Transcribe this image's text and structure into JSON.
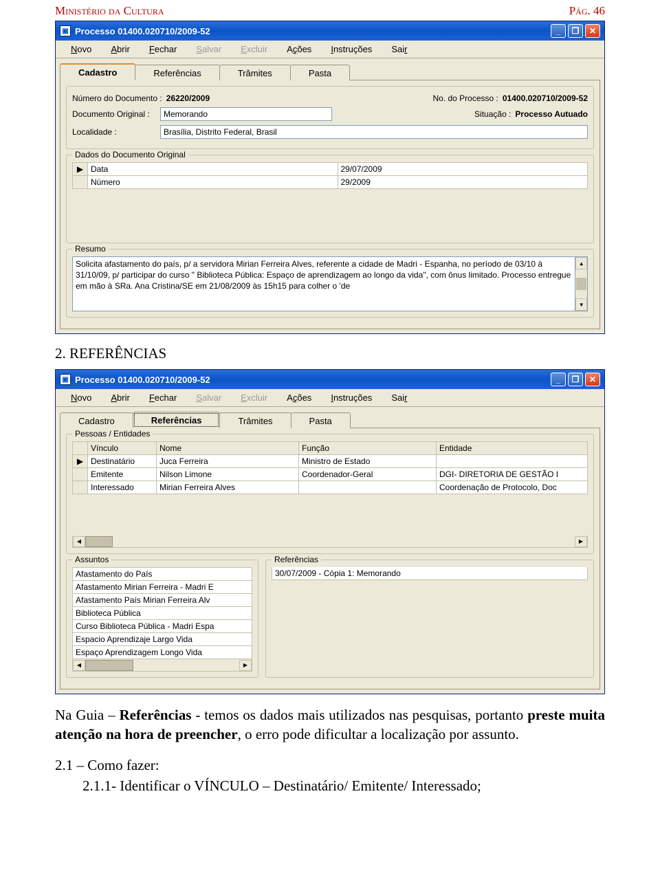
{
  "doc": {
    "ministry": "Ministério da Cultura",
    "page": "Pág. 46",
    "section_title": "2. REFERÊNCIAS",
    "paragraph1_a": "Na Guia – ",
    "paragraph1_b": "Referências",
    "paragraph1_c": " - temos os dados mais utilizados nas pesquisas, portanto ",
    "paragraph1_d": "preste muita atenção na hora de preencher",
    "paragraph1_e": ", o erro pode dificultar a localização por assunto.",
    "paragraph2": "2.1 – Como fazer:",
    "paragraph3": "2.1.1- Identificar o VÍNCULO – Destinatário/ Emitente/ Interessado;"
  },
  "win1": {
    "title": "Processo 01400.020710/2009-52",
    "minimize": "_",
    "restore": "❐",
    "close": "✕",
    "menu": {
      "novo": "Novo",
      "abrir": "Abrir",
      "fechar": "Fechar",
      "salvar": "Salvar",
      "excluir": "Excluir",
      "acoes": "Ações",
      "instrucoes": "Instruções",
      "sair": "Sair"
    },
    "tabs": {
      "cadastro": "Cadastro",
      "referencias": "Referências",
      "tramites": "Trâmites",
      "pasta": "Pasta"
    },
    "fields": {
      "num_doc_label": "Número do Documento :",
      "num_doc_value": "26220/2009",
      "no_proc_label": "No. do Processo :",
      "no_proc_value": "01400.020710/2009-52",
      "doc_orig_label": "Documento Original :",
      "doc_orig_value": "Memorando",
      "situacao_label": "Situação :",
      "situacao_value": "Processo Autuado",
      "localidade_label": "Localidade :",
      "localidade_value": "Brasília, Distrito Federal, Brasil"
    },
    "orig_legend": "Dados do Documento Original",
    "orig_rows": [
      {
        "k": "Data",
        "v": "29/07/2009"
      },
      {
        "k": "Número",
        "v": "29/2009"
      }
    ],
    "resumo_legend": "Resumo",
    "resumo_text": "Solicita afastamento do país, p/ a servidora Mirian Ferreira Alves, referente a cidade de Madri - Espanha, no período de 03/10 à 31/10/09, p/ participar do curso \" Biblioteca Pública: Espaço de aprendizagem ao longo da vida\", com ônus limitado. Processo entregue em mão à SRa. Ana Cristina/SE em 21/08/2009 às 15h15 para colher o 'de"
  },
  "win2": {
    "title": "Processo 01400.020710/2009-52",
    "minimize": "_",
    "restore": "❐",
    "close": "✕",
    "menu": {
      "novo": "Novo",
      "abrir": "Abrir",
      "fechar": "Fechar",
      "salvar": "Salvar",
      "excluir": "Excluir",
      "acoes": "Ações",
      "instrucoes": "Instruções",
      "sair": "Sair"
    },
    "tabs": {
      "cadastro": "Cadastro",
      "referencias": "Referências",
      "tramites": "Trâmites",
      "pasta": "Pasta"
    },
    "people_legend": "Pessoas / Entidades",
    "people_headers": {
      "vinculo": "Vínculo",
      "nome": "Nome",
      "funcao": "Função",
      "entidade": "Entidade"
    },
    "people_rows": [
      {
        "vinculo": "Destinatário",
        "nome": "Juca Ferreira",
        "funcao": "Ministro de Estado",
        "entidade": ""
      },
      {
        "vinculo": "Emitente",
        "nome": "Nilson Limone",
        "funcao": "Coordenador-Geral",
        "entidade": "DGI- DIRETORIA DE GESTÃO I"
      },
      {
        "vinculo": "Interessado",
        "nome": "Mirian Ferreira Alves",
        "funcao": "",
        "entidade": "Coordenação de Protocolo, Doc"
      }
    ],
    "assuntos_legend": "Assuntos",
    "assuntos": [
      "Afastamento do País",
      "Afastamento Mirian Ferreira - Madri E",
      "Afastamento País Mirian Ferreira Alv",
      "Biblioteca Pública",
      "Curso Biblioteca Pública - Madri Espa",
      "Espacio Aprendizaje Largo Vida",
      "Espaço Aprendizagem Longo Vida"
    ],
    "referencias_legend": "Referências",
    "referencias": [
      "30/07/2009 - Cópia 1: Memorando"
    ]
  }
}
